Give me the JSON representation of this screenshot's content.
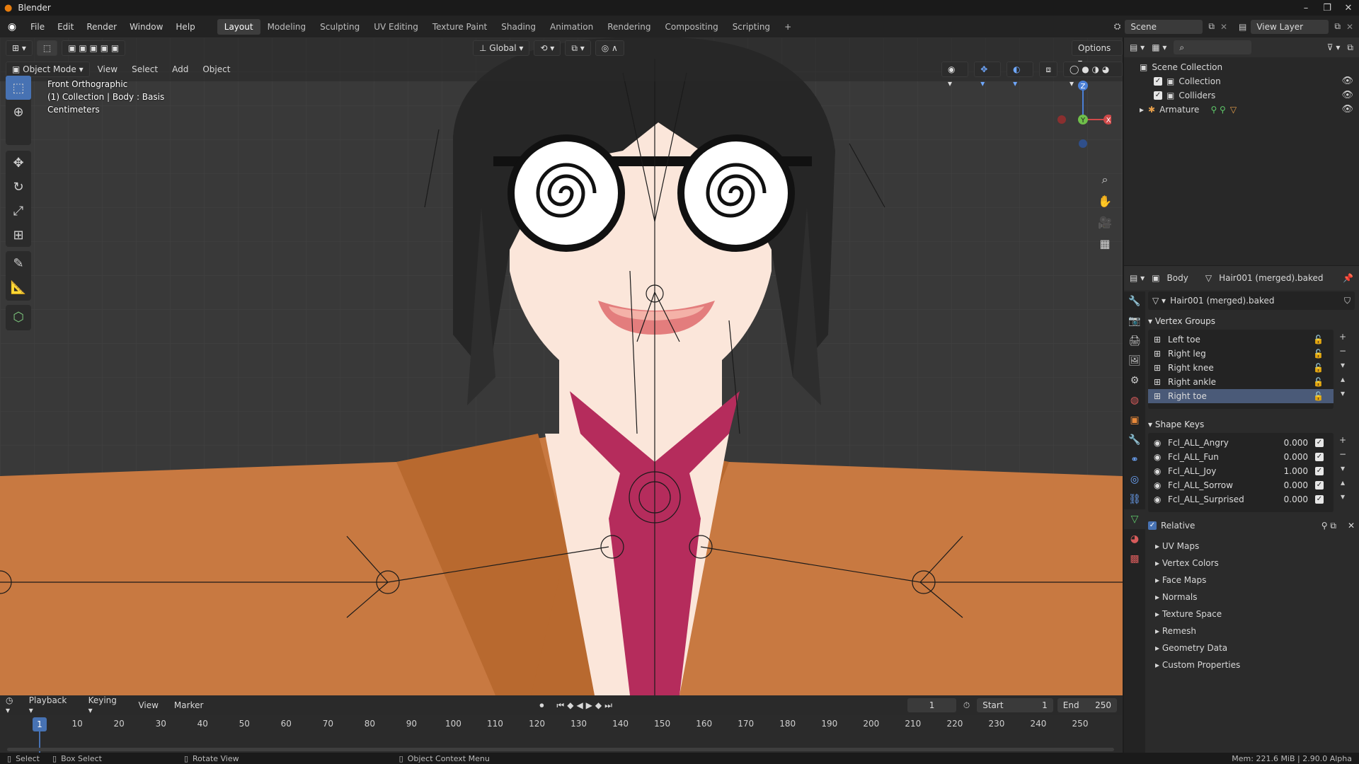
{
  "window": {
    "title": "Blender"
  },
  "menus": [
    "File",
    "Edit",
    "Render",
    "Window",
    "Help"
  ],
  "workspaces": [
    "Layout",
    "Modeling",
    "Sculpting",
    "UV Editing",
    "Texture Paint",
    "Shading",
    "Animation",
    "Rendering",
    "Compositing",
    "Scripting"
  ],
  "active_workspace": "Layout",
  "scene": {
    "name": "Scene",
    "view_layer": "View Layer"
  },
  "viewport": {
    "mode": "Object Mode",
    "menus": [
      "View",
      "Select",
      "Add",
      "Object"
    ],
    "transform_orientation": "Global",
    "options_label": "Options",
    "overlay_text": [
      "Front Orthographic",
      "(1) Collection | Body : Basis",
      "Centimeters"
    ],
    "axes": {
      "z": "Z",
      "y": "Y",
      "x": "X"
    }
  },
  "outliner": {
    "root": "Scene Collection",
    "items": [
      {
        "label": "Collection"
      },
      {
        "label": "Colliders"
      },
      {
        "label": "Armature"
      }
    ]
  },
  "properties": {
    "breadcrumb_object": "Body",
    "breadcrumb_mesh": "Hair001 (merged).baked",
    "mesh_name": "Hair001 (merged).baked",
    "vertex_groups_title": "Vertex Groups",
    "vertex_groups": [
      "Left toe",
      "Right leg",
      "Right knee",
      "Right ankle",
      "Right toe"
    ],
    "shape_keys_title": "Shape Keys",
    "shape_keys": [
      {
        "name": "Fcl_ALL_Angry",
        "value": "0.000"
      },
      {
        "name": "Fcl_ALL_Fun",
        "value": "0.000"
      },
      {
        "name": "Fcl_ALL_Joy",
        "value": "1.000"
      },
      {
        "name": "Fcl_ALL_Sorrow",
        "value": "0.000"
      },
      {
        "name": "Fcl_ALL_Surprised",
        "value": "0.000"
      }
    ],
    "relative_label": "Relative",
    "collapsed_panels": [
      "UV Maps",
      "Vertex Colors",
      "Face Maps",
      "Normals",
      "Texture Space",
      "Remesh",
      "Geometry Data",
      "Custom Properties"
    ]
  },
  "timeline": {
    "menus": [
      "Playback",
      "Keying",
      "View",
      "Marker"
    ],
    "current_frame": "1",
    "start_label": "Start",
    "start": "1",
    "end_label": "End",
    "end": "250",
    "ticks": [
      "1",
      "10",
      "20",
      "30",
      "40",
      "50",
      "60",
      "70",
      "80",
      "90",
      "100",
      "110",
      "120",
      "130",
      "140",
      "150",
      "160",
      "170",
      "180",
      "190",
      "200",
      "210",
      "220",
      "230",
      "240",
      "250"
    ]
  },
  "status": {
    "select": "Select",
    "box_select": "Box Select",
    "rotate_view": "Rotate View",
    "context_menu": "Object Context Menu",
    "memory": "Mem: 221.6 MiB | 2.90.0 Alpha"
  },
  "colors": {
    "accent": "#4772b3",
    "jacket": "#c87941",
    "tie": "#b52c5c",
    "skin": "#fbe6da"
  }
}
